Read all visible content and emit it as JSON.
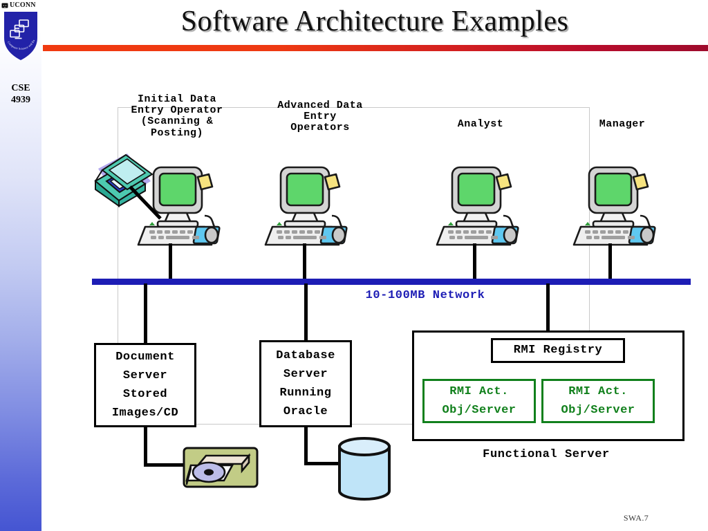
{
  "slide": {
    "title": "Software Architecture Examples",
    "footer_code": "SWA.7",
    "accent_start": "#f03a10",
    "accent_end": "#9e0b2c",
    "bus_color": "#1d1db5",
    "green": "#11801c"
  },
  "sidebar": {
    "wordmark": "UCONN",
    "shield_alt": "uconn-cse-shield",
    "course_code_line1": "CSE",
    "course_code_line2": "4939",
    "shield_color": "#2222a8",
    "gradient_bottom": "#4555d2"
  },
  "roles": [
    {
      "id": "initial-data-entry-operator",
      "label": "Initial Data\nEntry Operator\n(Scanning &\nPosting)"
    },
    {
      "id": "advanced-data-entry-operators",
      "label": "Advanced Data\nEntry\nOperators"
    },
    {
      "id": "analyst",
      "label": "Analyst"
    },
    {
      "id": "manager",
      "label": "Manager"
    }
  ],
  "network": {
    "label": "10-100MB Network"
  },
  "servers": [
    {
      "id": "document-server",
      "lines": [
        "Document",
        "Server",
        "Stored",
        "Images/CD"
      ]
    },
    {
      "id": "database-server",
      "lines": [
        "Database",
        "Server",
        "Running",
        "Oracle"
      ]
    }
  ],
  "functional_server": {
    "caption": "Functional Server",
    "registry": "RMI Registry",
    "objects": [
      {
        "id": "rmi-act-obj-server-1",
        "lines": [
          "RMI Act.",
          "Obj/Server"
        ]
      },
      {
        "id": "rmi-act-obj-server-2",
        "lines": [
          "RMI Act.",
          "Obj/Server"
        ]
      }
    ]
  },
  "icons": {
    "scanner": "flatbed-scanner-icon",
    "workstation": "desktop-computer-icon",
    "cd": "cd-drive-icon",
    "database": "database-cylinder-icon"
  }
}
